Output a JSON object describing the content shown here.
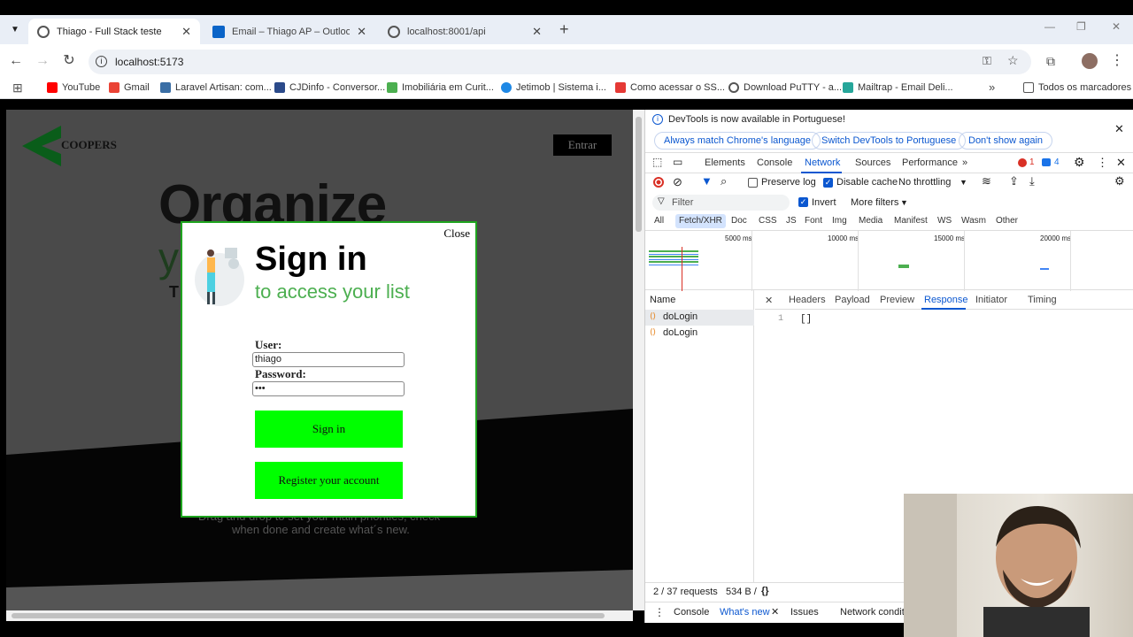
{
  "tabs": [
    {
      "title": "Thiago - Full Stack teste",
      "icon": "globe-icon"
    },
    {
      "title": "Email – Thiago AP – Outlook",
      "icon": "outlook-icon"
    },
    {
      "title": "localhost:8001/api",
      "icon": "globe-icon"
    }
  ],
  "address": {
    "url": "localhost:5173"
  },
  "bookmarks": [
    {
      "label": "YouTube",
      "color": "#ff0000"
    },
    {
      "label": "Gmail",
      "color": "#ea4335"
    },
    {
      "label": "Laravel Artisan: com...",
      "color": "#3a6ea5"
    },
    {
      "label": "CJDinfo - Conversor...",
      "color": "#2b4a8a"
    },
    {
      "label": "Imobiliária em Curit...",
      "color": "#4caf50"
    },
    {
      "label": "Jetimob | Sistema i...",
      "color": "#1e88e5"
    },
    {
      "label": "Como acessar o SS...",
      "color": "#e53935"
    },
    {
      "label": "Download PuTTY - a...",
      "color": "#555555"
    },
    {
      "label": "Mailtrap - Email Deli...",
      "color": "#26a69a"
    }
  ],
  "bookmarks_all": "Todos os marcadores",
  "site": {
    "logo": "COOPERS",
    "entrar": "Entrar",
    "headline": "Organize",
    "headline_y": "y",
    "headline_t": "T",
    "bottom_text1": "Drag and drop to set your main priorities, check",
    "bottom_text2": "when done and create what´s new."
  },
  "modal": {
    "close": "Close",
    "title": "Sign in",
    "subtitle": "to access your list",
    "user_label": "User:",
    "user_value": "thiago",
    "password_label": "Password:",
    "password_value": "•••",
    "signin": "Sign in",
    "register": "Register your account"
  },
  "devtools": {
    "banner": "DevTools is now available in Portuguese!",
    "btn1": "Always match Chrome's language",
    "btn2": "Switch DevTools to Portuguese",
    "btn3": "Don't show again",
    "tabs": [
      "Elements",
      "Console",
      "Network",
      "Sources",
      "Performance"
    ],
    "errors": "1",
    "messages": "4",
    "preserve_log": "Preserve log",
    "disable_cache": "Disable cache",
    "throttling": "No throttling",
    "filter_placeholder": "Filter",
    "invert": "Invert",
    "more_filters": "More filters",
    "chips": [
      "All",
      "Fetch/XHR",
      "Doc",
      "CSS",
      "JS",
      "Font",
      "Img",
      "Media",
      "Manifest",
      "WS",
      "Wasm",
      "Other"
    ],
    "timeline": [
      "5000 ms",
      "10000 ms",
      "15000 ms",
      "20000 ms"
    ],
    "name_header": "Name",
    "requests": [
      "doLogin",
      "doLogin"
    ],
    "resp_tabs": [
      "Headers",
      "Payload",
      "Preview",
      "Response",
      "Initiator",
      "Timing"
    ],
    "line_no": "1",
    "response": "[]",
    "status_requests": "2 / 37 requests",
    "status_size": "534 B /",
    "drawer": [
      "Console",
      "What's new",
      "Issues",
      "Network conditi"
    ]
  }
}
